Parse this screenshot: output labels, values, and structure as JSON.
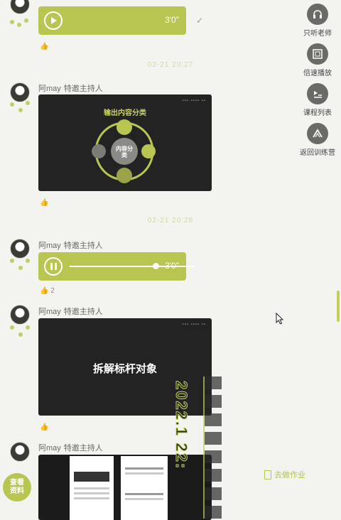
{
  "messages": [
    {
      "sender": "",
      "role": "",
      "type": "audio",
      "duration": "3'0\""
    },
    {
      "sender": "阿may",
      "role": "特邀主持人",
      "type": "image",
      "slide_title": "输出内容分类",
      "center_text": "内容分类"
    },
    {
      "sender": "阿may",
      "role": "特邀主持人",
      "type": "audio",
      "duration": "3'0\"",
      "like_count": "2"
    },
    {
      "sender": "阿may",
      "role": "特邀主持人",
      "type": "image",
      "slide_title": "拆解标杆对象"
    },
    {
      "sender": "阿may",
      "role": "特邀主持人",
      "type": "image",
      "slide_title": ""
    }
  ],
  "timestamps": [
    "02-21 20:27",
    "02-21 20:28"
  ],
  "rail": [
    {
      "label": "只听老师",
      "icon": "headphones-icon"
    },
    {
      "label": "倍速播放",
      "icon": "speed-icon"
    },
    {
      "label": "课程列表",
      "icon": "course-list-icon"
    },
    {
      "label": "返回训练营",
      "icon": "return-camp-icon"
    }
  ],
  "overlay": {
    "vertical_text": "2022.1 22:",
    "homework": "去做作业",
    "fab": "查看\n资料"
  },
  "colors": {
    "accent": "#b9c551",
    "slide_bg": "#232323",
    "page_bg": "#f3f3f0"
  }
}
